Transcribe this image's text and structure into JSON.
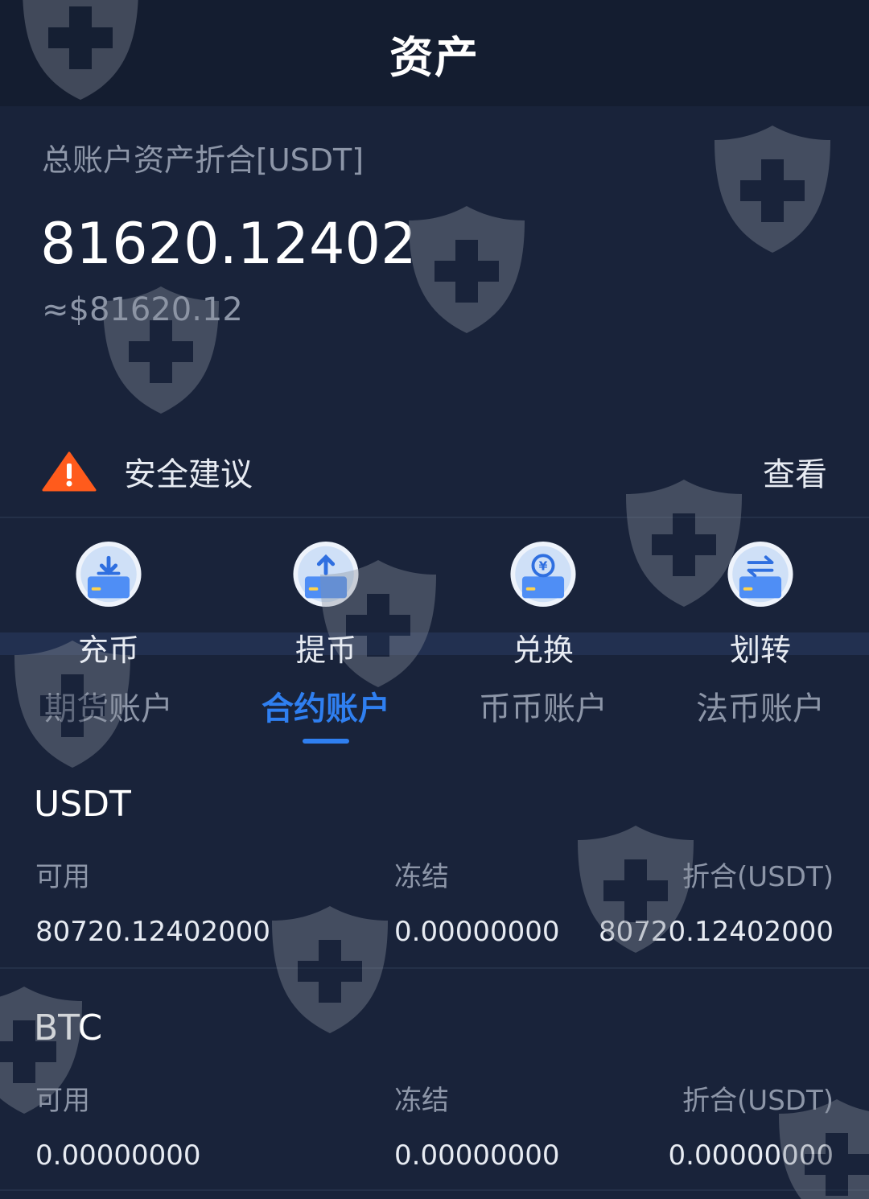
{
  "header": {
    "title": "资产"
  },
  "balance": {
    "label": "总账户资产折合[USDT]",
    "total": "81620.12402",
    "fiat": "≈$81620.12"
  },
  "security": {
    "label": "安全建议",
    "view": "查看",
    "warning_color": "#ff5b1c"
  },
  "actions": [
    {
      "label": "充币",
      "icon": "deposit-icon"
    },
    {
      "label": "提币",
      "icon": "withdraw-icon"
    },
    {
      "label": "兑换",
      "icon": "exchange-icon"
    },
    {
      "label": "划转",
      "icon": "transfer-icon"
    }
  ],
  "tabs": [
    {
      "label": "期货账户",
      "active": false
    },
    {
      "label": "合约账户",
      "active": true
    },
    {
      "label": "币币账户",
      "active": false
    },
    {
      "label": "法币账户",
      "active": false
    }
  ],
  "assets": [
    {
      "name": "USDT",
      "available_label": "可用",
      "frozen_label": "冻结",
      "converted_label": "折合(USDT)",
      "available": "80720.12402000",
      "frozen": "0.00000000",
      "converted": "80720.12402000"
    },
    {
      "name": "BTC",
      "available_label": "可用",
      "frozen_label": "冻结",
      "converted_label": "折合(USDT)",
      "available": "0.00000000",
      "frozen": "0.00000000",
      "converted": "0.00000000"
    }
  ],
  "colors": {
    "background": "#19233a",
    "header": "#141d30",
    "accent": "#2f7ff0",
    "muted": "#8d96a8"
  },
  "watermark_icon": "shield-plus-icon"
}
